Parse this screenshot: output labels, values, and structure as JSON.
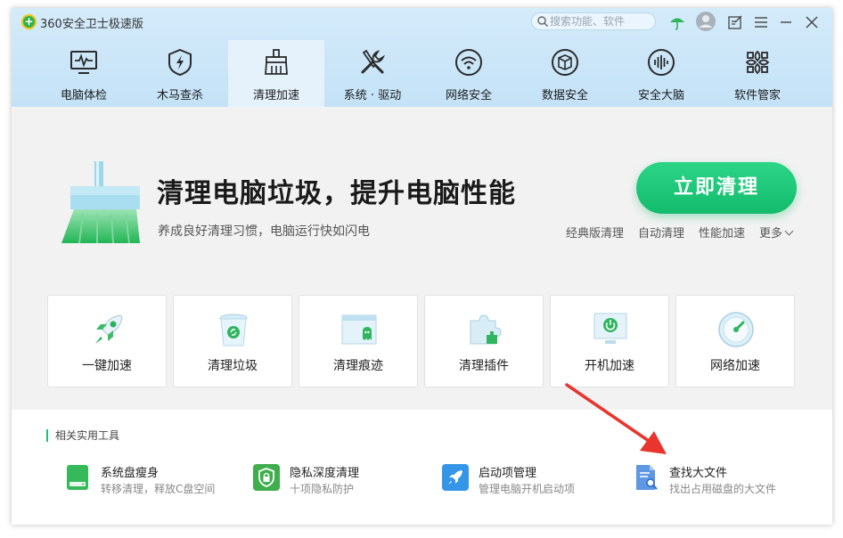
{
  "window": {
    "title": "360安全卫士极速版",
    "logo_glyph": "+",
    "search_placeholder": "搜索功能、软件"
  },
  "title_bar_icons": [
    "umbrella-icon",
    "avatar",
    "feedback-icon",
    "menu-icon",
    "minimize-icon",
    "close-icon"
  ],
  "nav": {
    "active_index": 2,
    "items": [
      {
        "label": "电脑体检",
        "icon": "monitor-pulse-icon"
      },
      {
        "label": "木马查杀",
        "icon": "shield-bolt-icon"
      },
      {
        "label": "清理加速",
        "icon": "broom-icon"
      },
      {
        "label": "系统 · 驱动",
        "icon": "wrench-screwdriver-icon"
      },
      {
        "label": "网络安全",
        "icon": "wifi-icon"
      },
      {
        "label": "数据安全",
        "icon": "cube-icon"
      },
      {
        "label": "安全大脑",
        "icon": "soundwave-icon"
      },
      {
        "label": "软件管家",
        "icon": "apps-icon"
      }
    ]
  },
  "hero": {
    "title": "清理电脑垃圾，提升电脑性能",
    "subtitle": "养成良好清理习惯，电脑运行快如闪电",
    "primary_button": "立即清理",
    "links": [
      "经典版清理",
      "自动清理",
      "性能加速"
    ],
    "more_label": "更多"
  },
  "tiles": [
    {
      "label": "一键加速",
      "icon": "rocket-icon"
    },
    {
      "label": "清理垃圾",
      "icon": "recycle-bin-icon"
    },
    {
      "label": "清理痕迹",
      "icon": "browser-ghost-icon"
    },
    {
      "label": "清理插件",
      "icon": "puzzle-icon"
    },
    {
      "label": "开机加速",
      "icon": "power-monitor-icon"
    },
    {
      "label": "网络加速",
      "icon": "speedometer-icon"
    }
  ],
  "tools": {
    "section_title": "相关实用工具",
    "items": [
      {
        "name": "系统盘瘦身",
        "desc": "转移清理，释放C盘空间",
        "icon": "disk-icon",
        "color": "#35b95a"
      },
      {
        "name": "隐私深度清理",
        "desc": "十项隐私防护",
        "icon": "privacy-shield-icon",
        "color": "#3fae4c"
      },
      {
        "name": "启动项管理",
        "desc": "管理电脑开机启动项",
        "icon": "startup-rocket-icon",
        "color": "#3596e8"
      },
      {
        "name": "查找大文件",
        "desc": "找出占用磁盘的大文件",
        "icon": "file-search-icon",
        "color": "#5e97e2"
      }
    ]
  },
  "colors": {
    "accent_green": "#12bc6c",
    "header_blue": "#c4e2f7",
    "annotation_red": "#e8352d"
  }
}
